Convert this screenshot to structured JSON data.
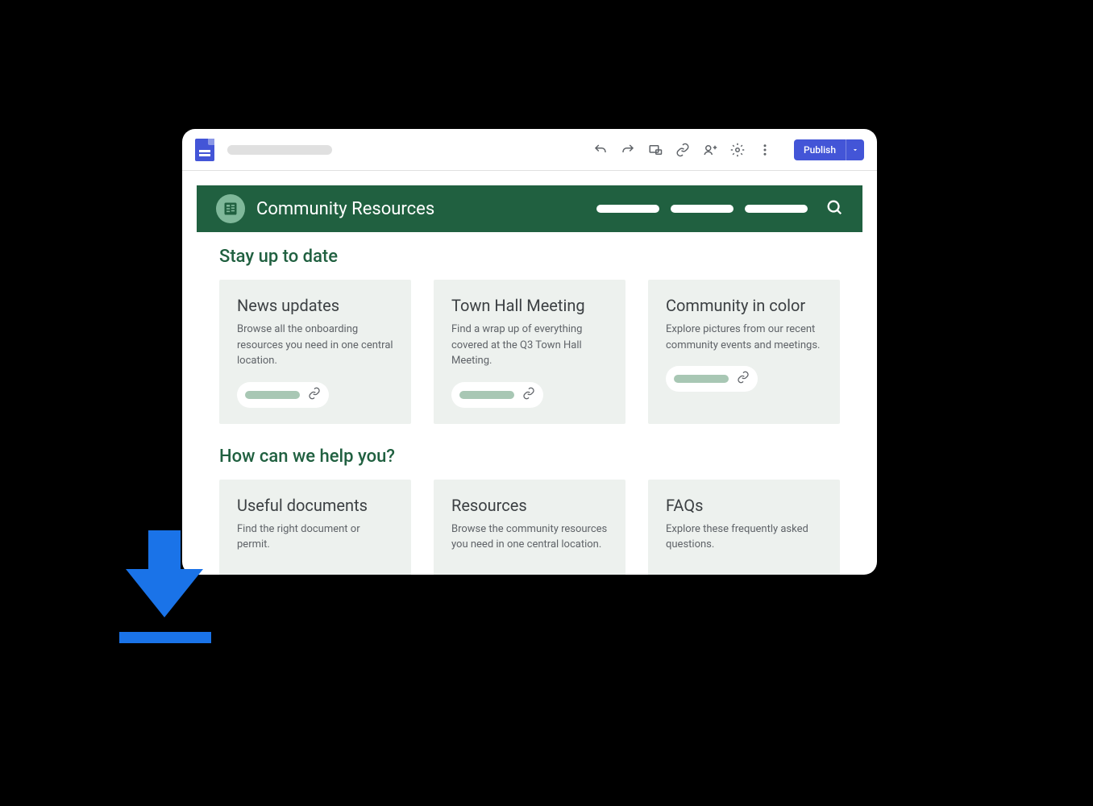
{
  "toolbar": {
    "publish_label": "Publish"
  },
  "site": {
    "title": "Community Resources"
  },
  "sections": [
    {
      "heading": "Stay up to date",
      "cards": [
        {
          "title": "News updates",
          "desc": "Browse all the onboarding resources you need in one central location."
        },
        {
          "title": "Town Hall Meeting",
          "desc": "Find a wrap up of everything covered at the Q3 Town Hall Meeting."
        },
        {
          "title": "Community in color",
          "desc": "Explore pictures from our recent community events and meetings."
        }
      ]
    },
    {
      "heading": "How can we help you?",
      "cards": [
        {
          "title": "Useful documents",
          "desc": "Find the right document or permit."
        },
        {
          "title": "Resources",
          "desc": "Browse the community resources you need in one central location."
        },
        {
          "title": "FAQs",
          "desc": "Explore these frequently asked questions."
        }
      ]
    }
  ]
}
